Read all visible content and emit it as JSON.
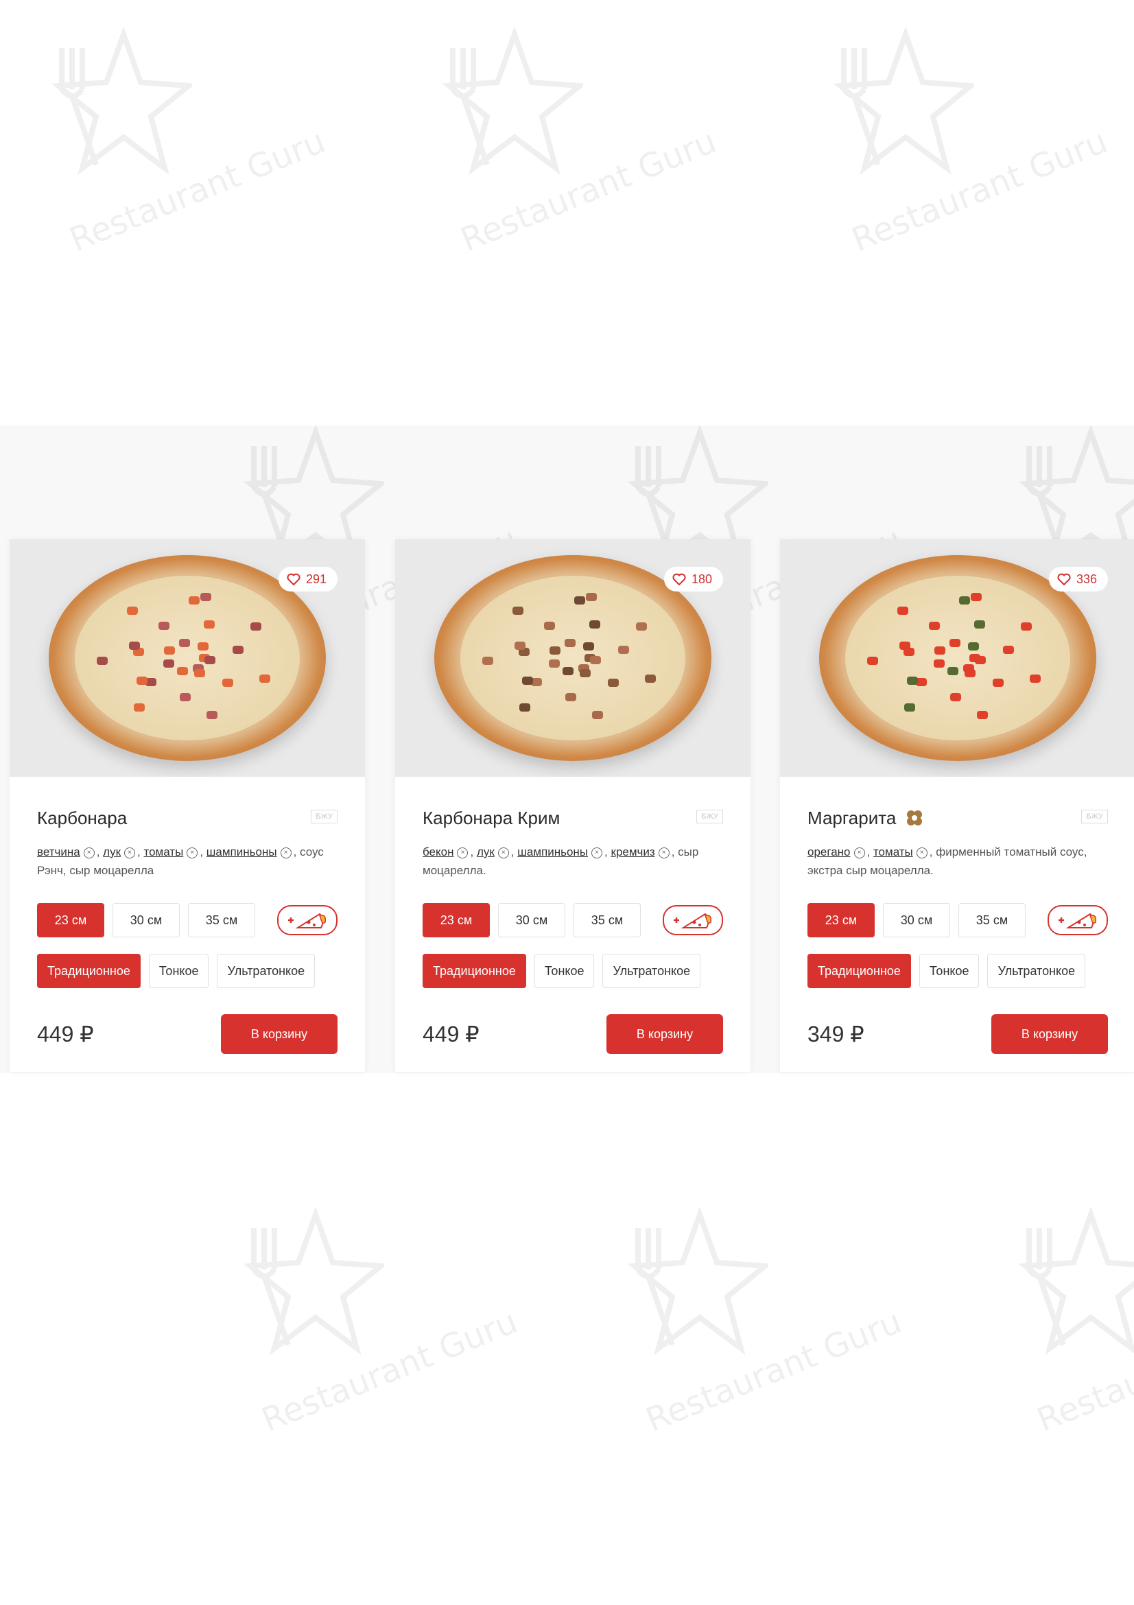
{
  "watermark_text": "Restaurant Guru",
  "colors": {
    "accent": "#d7322e",
    "like": "#d32f2f"
  },
  "nutrition_label": "БЖУ",
  "sizes": [
    "23 см",
    "30 см",
    "35 см"
  ],
  "crusts": [
    "Традиционное",
    "Тонкое",
    "Ультратонкое"
  ],
  "cart_label": "В корзину",
  "currency": "₽",
  "products": [
    {
      "name": "Карбонара",
      "likes": "291",
      "ingredients_removable": [
        "ветчина",
        "лук",
        "томаты",
        "шампиньоны"
      ],
      "ingredients_fixed": "соус Рэнч, сыр моцарелла",
      "price": "449",
      "selected_size": "23 см",
      "selected_crust": "Традиционное",
      "vegetarian_icon": false
    },
    {
      "name": "Карбонара Крим",
      "likes": "180",
      "ingredients_removable": [
        "бекон",
        "лук",
        "шампиньоны",
        "кремчиз"
      ],
      "ingredients_fixed": "сыр моцарелла.",
      "price": "449",
      "selected_size": "23 см",
      "selected_crust": "Традиционное",
      "vegetarian_icon": false
    },
    {
      "name": "Маргарита",
      "likes": "336",
      "ingredients_removable": [
        "орегано",
        "томаты"
      ],
      "ingredients_fixed": "фирменный томатный соус, экстра сыр моцарелла.",
      "price": "349",
      "selected_size": "23 см",
      "selected_crust": "Традиционное",
      "vegetarian_icon": true
    }
  ]
}
